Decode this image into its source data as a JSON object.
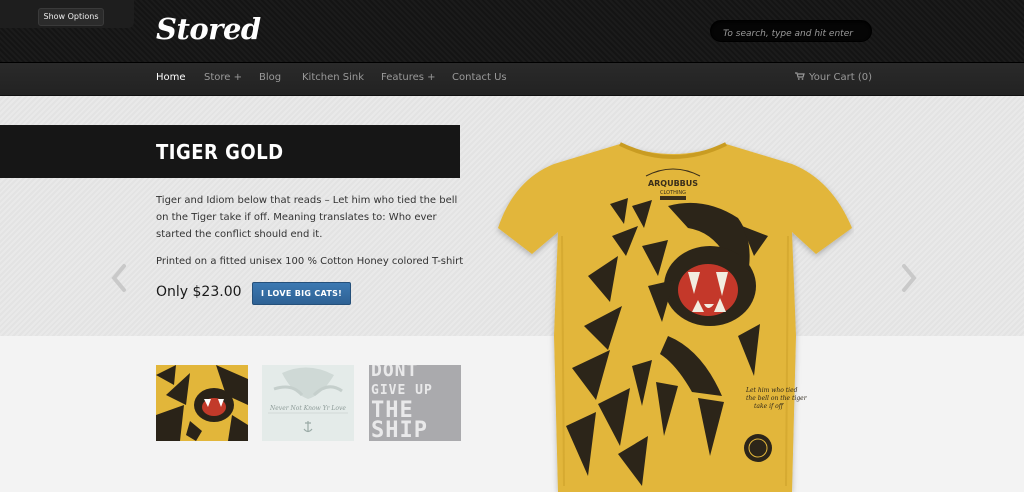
{
  "header": {
    "options_button": "Show Options",
    "logo": "Stored",
    "search_placeholder": "To search, type and hit enter"
  },
  "nav": {
    "items": [
      {
        "label": "Home",
        "active": true
      },
      {
        "label": "Store +"
      },
      {
        "label": "Blog"
      },
      {
        "label": "Kitchen Sink"
      },
      {
        "label": "Features +"
      },
      {
        "label": "Contact Us"
      }
    ],
    "cart": "Your Cart (0)"
  },
  "product": {
    "title": "TIGER GOLD",
    "description": "Tiger and Idiom below that reads – Let him who tied the bell on the Tiger take if off. Meaning translates to: Who ever started the conflict should end it.",
    "detail": "Printed on a fitted unisex 100 % Cotton Honey colored T-shirt",
    "price": "Only $23.00",
    "cta": "I LOVE BIG CATS!"
  },
  "shirt": {
    "brand": "ARQUBBUS",
    "brand_sub": "CLOTHING",
    "quote": "Let him who tied the bell on the tiger take if off"
  },
  "thumbnails": [
    {
      "name": "tiger-gold"
    },
    {
      "name": "white-shirt",
      "caption": "Never Not Know Yr Love"
    },
    {
      "name": "dont-give-up",
      "lines": [
        "DONT",
        "GIVE UP",
        "THE",
        "SHIP"
      ]
    }
  ],
  "colors": {
    "shirt_yellow": "#e2b63a",
    "cta_blue": "#336699",
    "header_dark": "#161616"
  }
}
